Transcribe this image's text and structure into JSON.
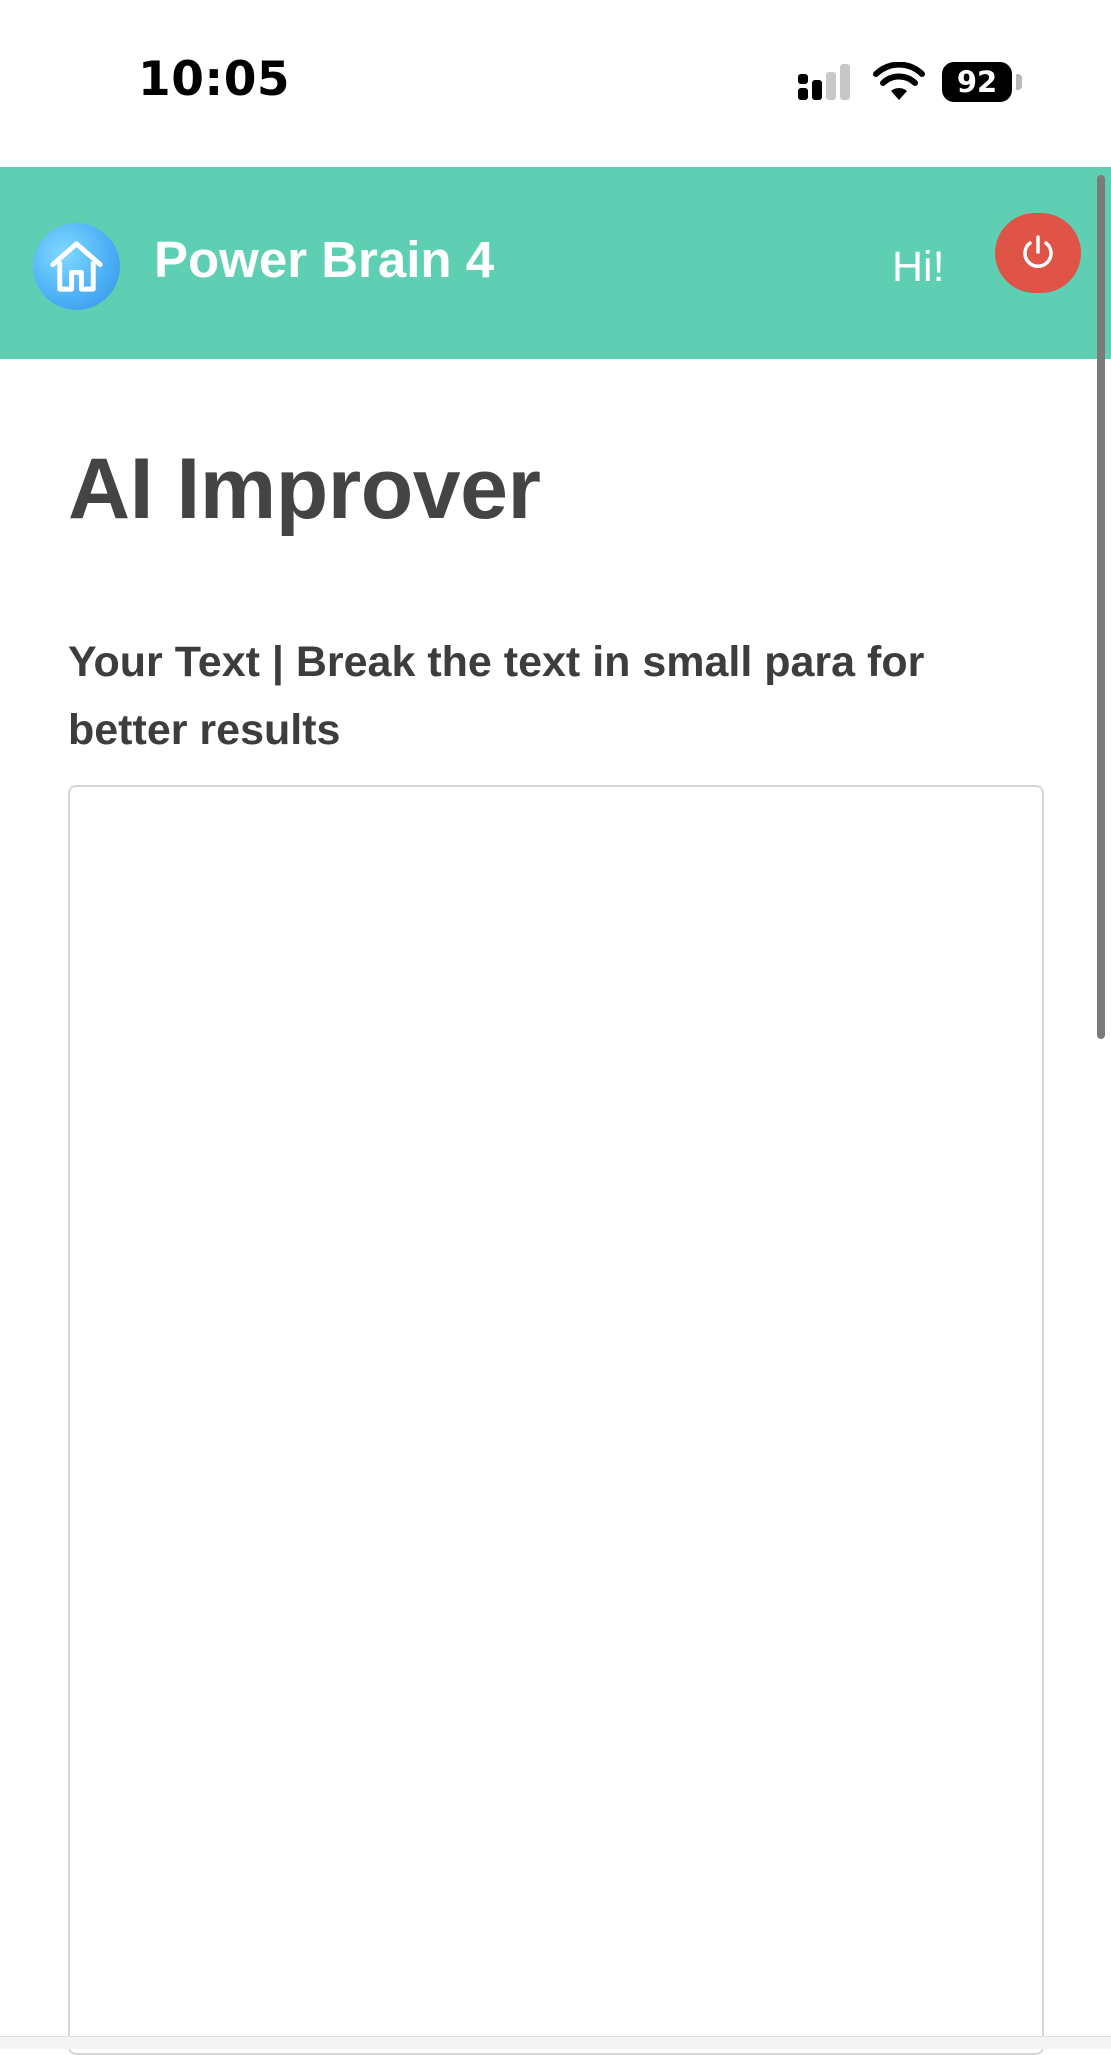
{
  "status_bar": {
    "time": "10:05",
    "battery_level": "92",
    "icons": [
      "signal-icon",
      "wifi-icon",
      "battery-icon"
    ]
  },
  "header": {
    "app_title": "Power Brain 4",
    "greeting": "Hi!",
    "home_icon": "home-icon",
    "power_icon": "power-icon",
    "colors": {
      "bar": "#5ecfb2",
      "power_button": "#e05347",
      "home_logo": "#4aaef5"
    }
  },
  "main": {
    "page_title": "AI Improver",
    "text_label": "Your Text | Break the text in small para for better results",
    "text_input_value": "",
    "text_input_placeholder": ""
  }
}
